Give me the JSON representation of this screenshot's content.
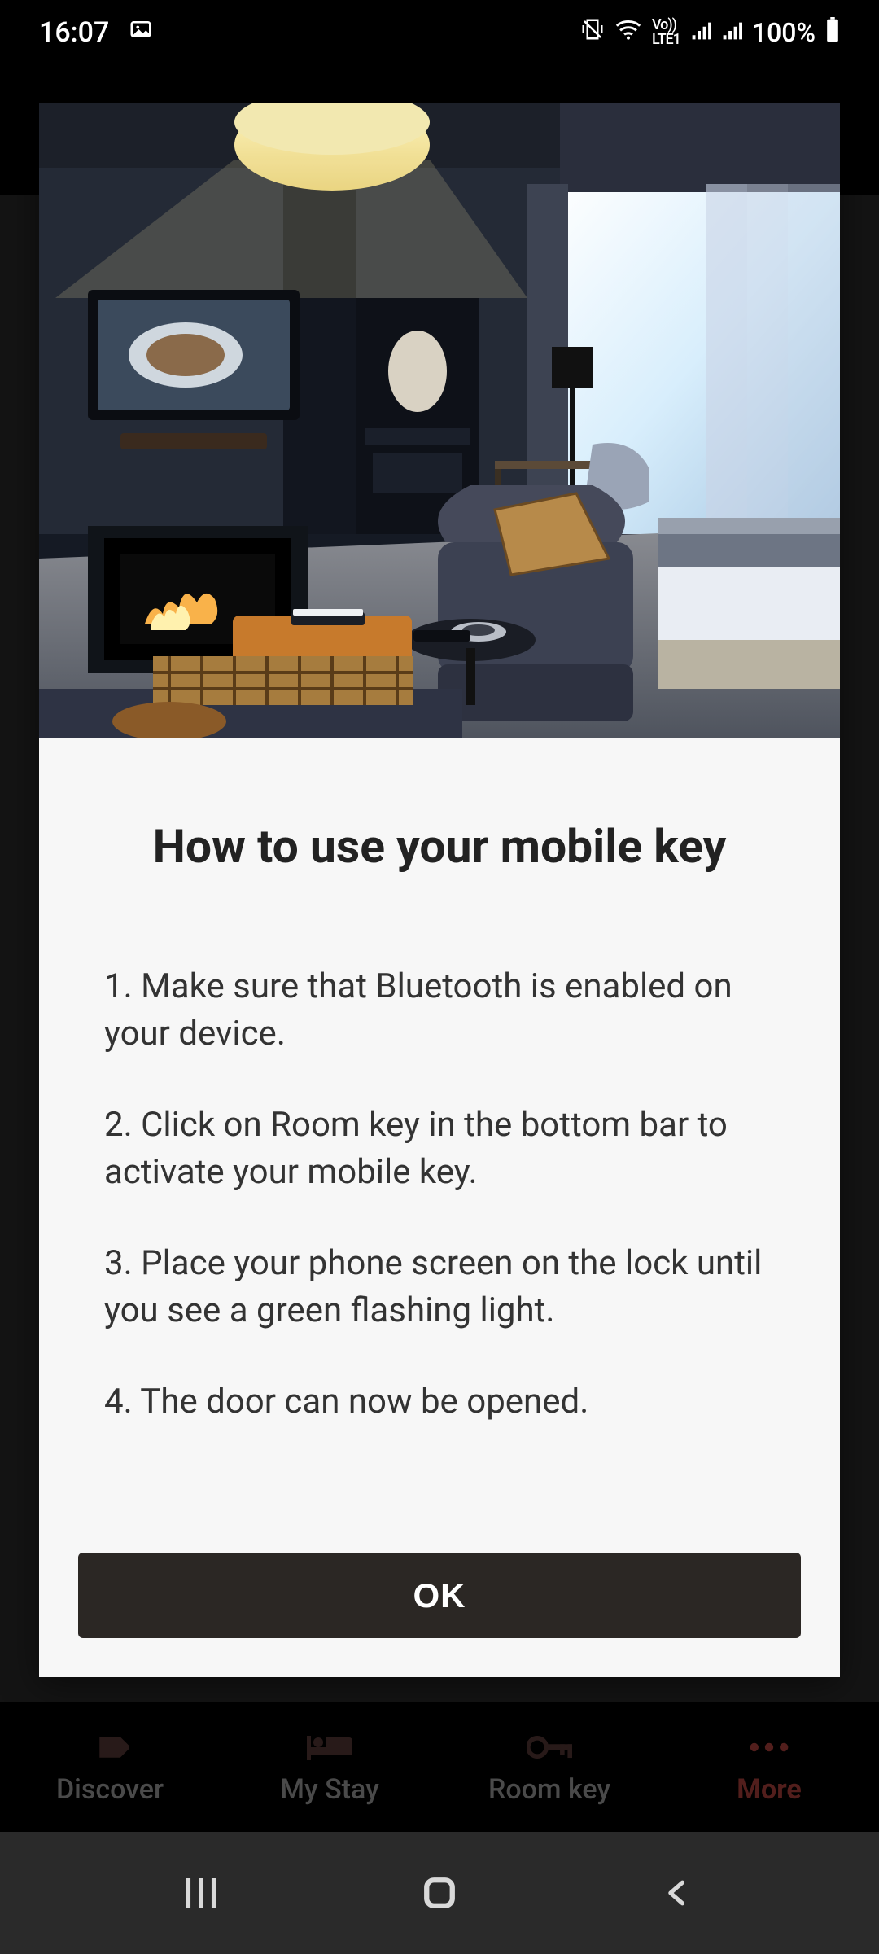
{
  "status": {
    "time": "16:07",
    "battery": "100%",
    "network_badge": "Vo))\nLTE1"
  },
  "modal": {
    "title": "How to use your mobile key",
    "steps": [
      "1. Make sure that Bluetooth is enabled on your device.",
      "2. Click on Room key in the bottom bar to activate your mobile key.",
      "3. Place your phone screen on the lock until you see a green flashing light.",
      "4. The door can now be opened."
    ],
    "ok_label": "OK"
  },
  "tabs": {
    "discover": "Discover",
    "mystay": "My Stay",
    "roomkey": "Room key",
    "more": "More"
  }
}
